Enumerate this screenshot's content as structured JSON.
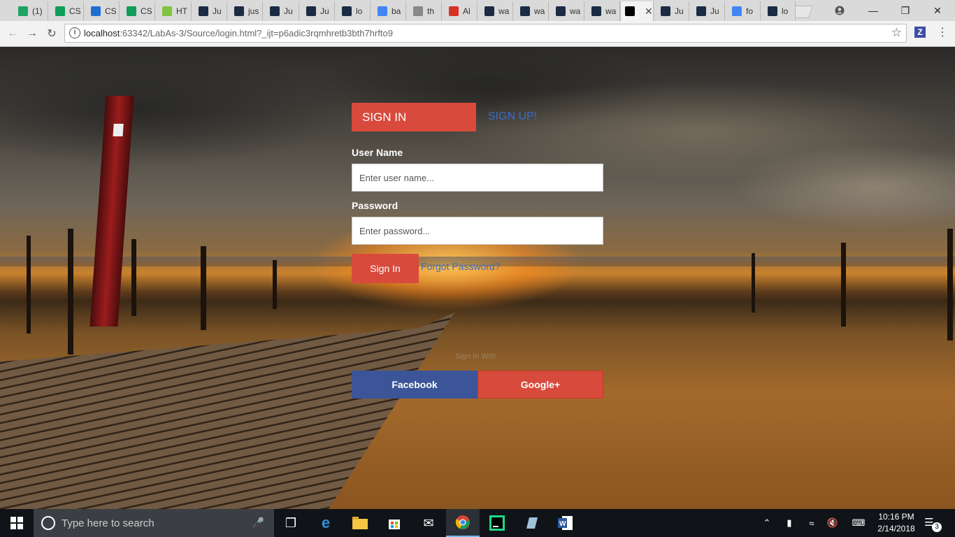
{
  "browser": {
    "tabs": [
      {
        "label": "(1)",
        "icon": "notification-icon",
        "color": "#1da462"
      },
      {
        "label": "CS",
        "icon": "sheets-icon",
        "color": "#0f9d58"
      },
      {
        "label": "CS",
        "icon": "box-icon",
        "color": "#1f6fd1"
      },
      {
        "label": "CS",
        "icon": "sheets-icon",
        "color": "#0f9d58"
      },
      {
        "label": "HT",
        "icon": "wix-icon",
        "color": "#82c341"
      },
      {
        "label": "Ju",
        "icon": "webstorm-icon",
        "color": "#1c2b44"
      },
      {
        "label": "jus",
        "icon": "webstorm-icon",
        "color": "#1c2b44"
      },
      {
        "label": "Ju",
        "icon": "webstorm-icon",
        "color": "#1c2b44"
      },
      {
        "label": "Ju",
        "icon": "webstorm-icon",
        "color": "#1c2b44"
      },
      {
        "label": "lo",
        "icon": "webstorm-icon",
        "color": "#1c2b44"
      },
      {
        "label": "ba",
        "icon": "google-icon",
        "color": "#4285f4"
      },
      {
        "label": "th",
        "icon": "document-icon",
        "color": "#888888"
      },
      {
        "label": "Al",
        "icon": "alert-icon",
        "color": "#d93025"
      },
      {
        "label": "wa",
        "icon": "webstorm-icon",
        "color": "#1c2b44"
      },
      {
        "label": "wa",
        "icon": "webstorm-icon",
        "color": "#1c2b44"
      },
      {
        "label": "wa",
        "icon": "webstorm-icon",
        "color": "#1c2b44"
      },
      {
        "label": "wa",
        "icon": "webstorm-icon",
        "color": "#1c2b44"
      },
      {
        "label": "",
        "icon": "webstorm-icon",
        "color": "#000000",
        "active": true
      },
      {
        "label": "Ju",
        "icon": "webstorm-icon",
        "color": "#1c2b44"
      },
      {
        "label": "Ju",
        "icon": "webstorm-icon",
        "color": "#1c2b44"
      },
      {
        "label": "fo",
        "icon": "google-icon",
        "color": "#4285f4"
      },
      {
        "label": "lo",
        "icon": "webstorm-icon",
        "color": "#1c2b44"
      }
    ],
    "url_host": "localhost",
    "url_rest": ":63342/LabAs-3/Source/login.html?_ijt=p6adic3rqmhretb3bth7hrfto9",
    "extension_label": "Z"
  },
  "login": {
    "tab_signin": "SIGN IN",
    "tab_signup": "SIGN UP!",
    "username_label": "User Name",
    "username_placeholder": "Enter user name...",
    "password_label": "Password",
    "password_placeholder": "Enter password...",
    "signin_button": "Sign In",
    "forgot_link": "Forgot Password?",
    "sign_in_with": "Sign In With",
    "facebook_button": "Facebook",
    "google_button": "Google+"
  },
  "taskbar": {
    "search_placeholder": "Type here to search",
    "time": "10:16 PM",
    "date": "2/14/2018",
    "notification_count": "3"
  },
  "colors": {
    "accent_red": "#d84a3c",
    "link_blue": "#3b6cc9",
    "facebook_blue": "#3b5598"
  }
}
